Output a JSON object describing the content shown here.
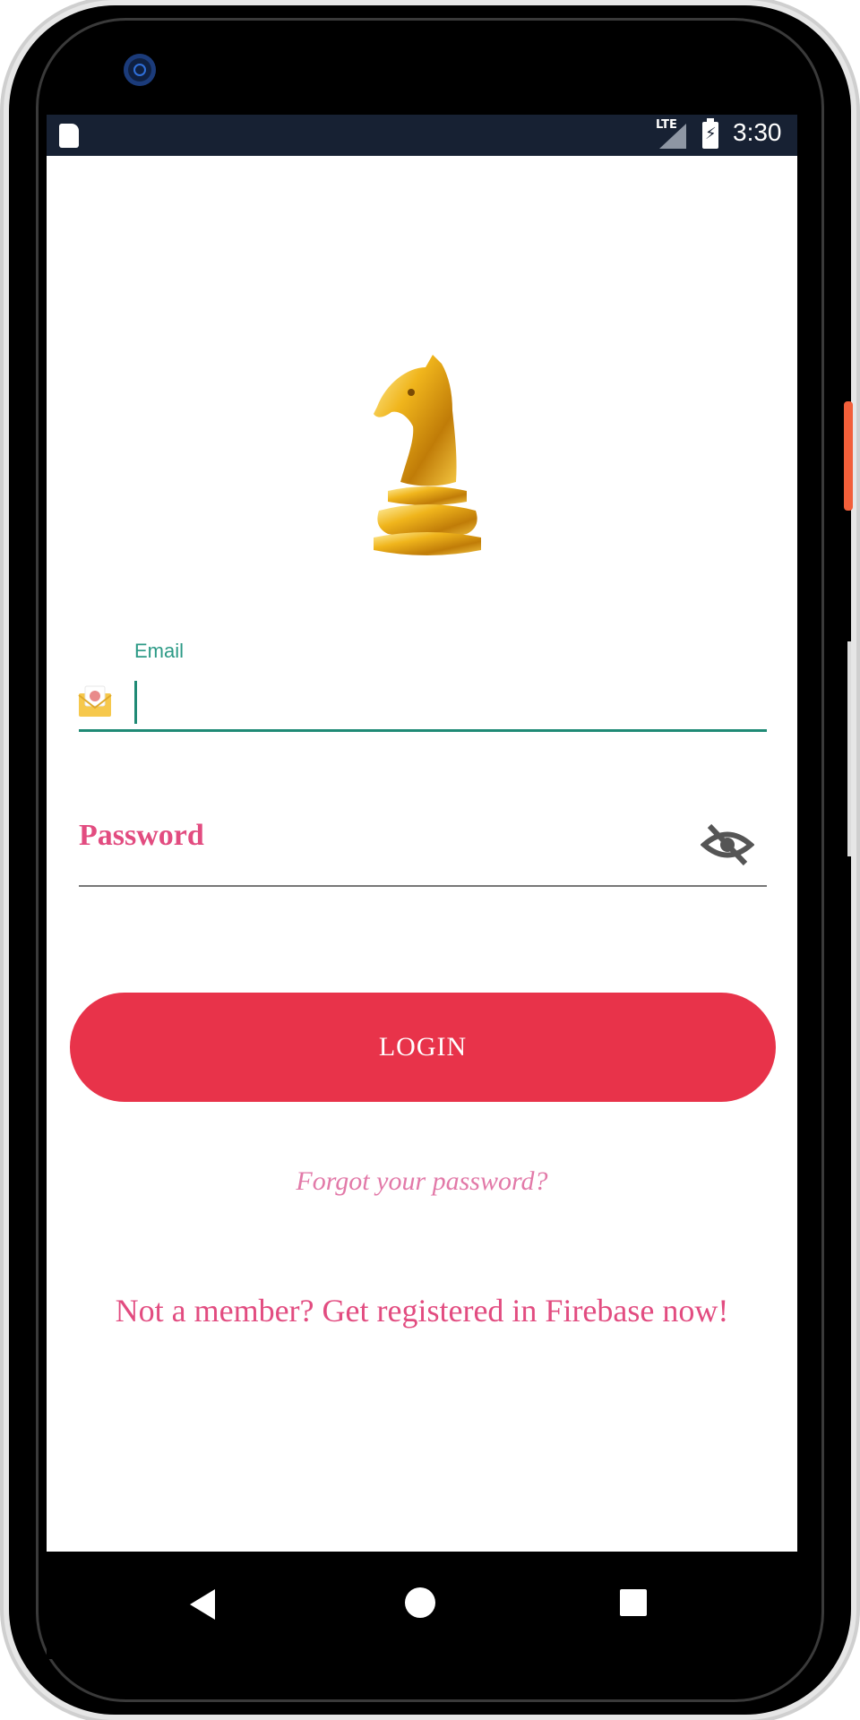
{
  "status_bar": {
    "time": "3:30",
    "network": "LTE",
    "icons": [
      "sd-card-icon",
      "signal-icon",
      "battery-charging-icon"
    ]
  },
  "login_form": {
    "email_label": "Email",
    "email_value": "",
    "password_label": "Password",
    "password_value": "",
    "login_button": "LOGIN",
    "forgot_link": "Forgot your password?",
    "register_link": "Not a member? Get registered in Firebase now!"
  },
  "colors": {
    "accent_teal": "#1f8a75",
    "pink_text": "#e24c80",
    "login_button": "#e8334a",
    "status_bar": "#172133"
  },
  "navigation": {
    "buttons": [
      "back",
      "home",
      "recents"
    ]
  }
}
